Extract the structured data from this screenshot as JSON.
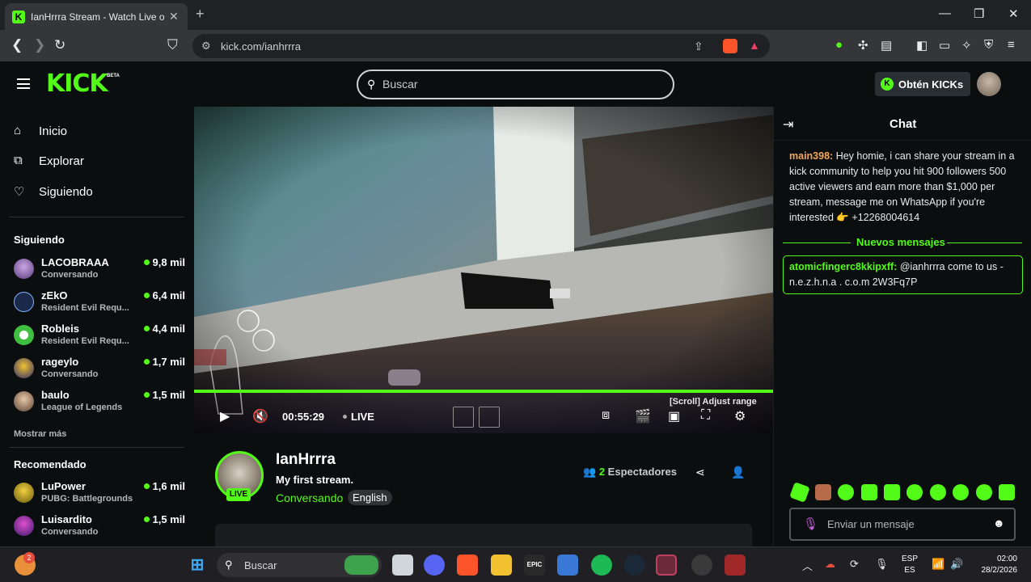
{
  "browser": {
    "tab_title": "IanHrrra Stream - Watch Live on",
    "url": "kick.com/ianhrrra",
    "new_tab_icon": "plus-icon",
    "window_controls": [
      "minimize-icon",
      "restore-icon",
      "close-icon"
    ]
  },
  "header": {
    "logo": "KICK",
    "logo_badge": "BETA",
    "search_placeholder": "Buscar",
    "kicks_button": "Obtén KICKs"
  },
  "sidebar": {
    "nav": [
      {
        "label": "Inicio",
        "icon": "home-icon"
      },
      {
        "label": "Explorar",
        "icon": "browse-icon"
      },
      {
        "label": "Siguiendo",
        "icon": "heart-icon"
      }
    ],
    "following_title": "Siguiendo",
    "following": [
      {
        "name": "LACOBRAAA",
        "category": "Conversando",
        "viewers": "9,8 mil"
      },
      {
        "name": "zEkO",
        "category": "Resident Evil Requ...",
        "viewers": "6,4 mil"
      },
      {
        "name": "Robleis",
        "category": "Resident Evil Requ...",
        "viewers": "4,4 mil"
      },
      {
        "name": "rageylo",
        "category": "Conversando",
        "viewers": "1,7 mil"
      },
      {
        "name": "baulo",
        "category": "League of Legends",
        "viewers": "1,5 mil"
      }
    ],
    "show_more": "Mostrar más",
    "recommended_title": "Recomendado",
    "recommended": [
      {
        "name": "LuPower",
        "category": "PUBG: Battlegrounds",
        "viewers": "1,6 mil"
      },
      {
        "name": "Luisardito",
        "category": "Conversando",
        "viewers": "1,5 mil"
      }
    ]
  },
  "player": {
    "scroll_hint": "[Scroll] Adjust range",
    "time": "00:55:29",
    "live_label": "LIVE",
    "progress": 1.0
  },
  "streamer": {
    "name": "IanHrrra",
    "title": "My first stream.",
    "category": "Conversando",
    "language": "English",
    "live_badge": "LIVE",
    "viewers_count": "2",
    "viewers_label": "Espectadores"
  },
  "chat": {
    "title": "Chat",
    "messages": [
      {
        "user": "main398:",
        "user_color": "#f2a65a",
        "text": "Hey homie, i can share your stream in a kick community to help you hit 900 followers 500 active viewers and earn more than $1,000 per stream, message me on WhatsApp if you're interested 👉 +12268004614"
      }
    ],
    "new_messages_label": "Nuevos mensajes",
    "highlighted": {
      "user": "atomicfingerc8kkipxff:",
      "user_color": "#53fc18",
      "text": "@ianhrrra come to us - n.e.z.h.n.a . c.o.m 2W3Fq7P"
    },
    "input_placeholder": "Enviar un mensaje"
  },
  "taskbar": {
    "search_label": "Buscar",
    "notification_count": "2",
    "lang_line1": "ESP",
    "lang_line2": "ES",
    "time": "02:00",
    "date": "28/2/2026"
  },
  "colors": {
    "accent": "#53fc18",
    "background": "#0b0e0f"
  }
}
